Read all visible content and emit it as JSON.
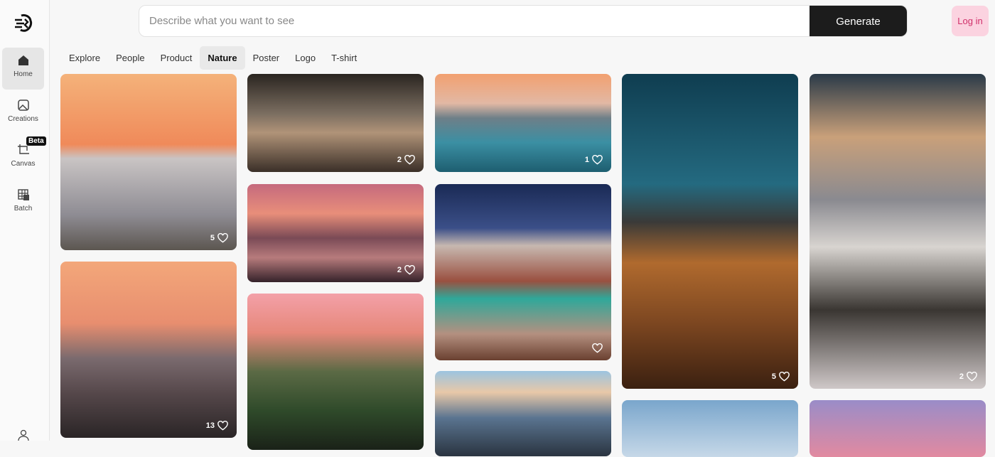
{
  "sidebar": {
    "items": [
      {
        "label": "Home"
      },
      {
        "label": "Creations"
      },
      {
        "label": "Canvas",
        "badge": "Beta"
      },
      {
        "label": "Batch"
      }
    ]
  },
  "search": {
    "placeholder": "Describe what you want to see",
    "generate_label": "Generate"
  },
  "header": {
    "login_label": "Log in"
  },
  "tabs": [
    "Explore",
    "People",
    "Product",
    "Nature",
    "Poster",
    "Logo",
    "T-shirt"
  ],
  "active_tab": "Nature",
  "cards": [
    {
      "likes": "5"
    },
    {
      "likes": "13"
    },
    {
      "likes": "2"
    },
    {
      "likes": "2"
    },
    {
      "likes": ""
    },
    {
      "likes": "1"
    },
    {
      "likes": ""
    },
    {
      "likes": ""
    },
    {
      "likes": "5"
    },
    {
      "likes": ""
    },
    {
      "likes": "2"
    },
    {
      "likes": ""
    }
  ]
}
